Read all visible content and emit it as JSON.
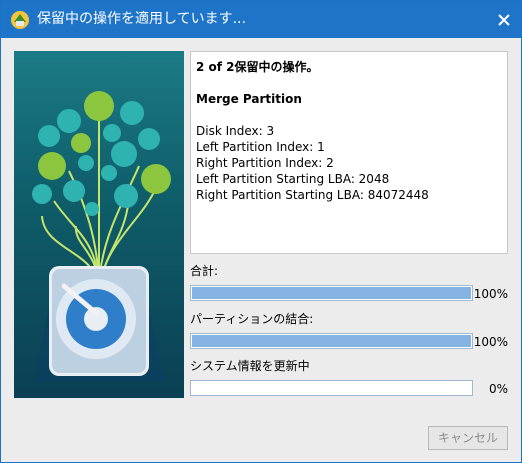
{
  "dialog": {
    "title": "保留中の操作を適用しています...",
    "colors": {
      "titlebar": "#1e74c9",
      "progress_fill": "#86b3e4",
      "illustration_bg": "#0f5f6b"
    }
  },
  "info": {
    "count": "2 of 2保留中の操作。",
    "operation": "Merge Partition",
    "details": [
      "Disk Index: 3",
      "Left Partition Index: 1",
      "Right Partition Index: 2",
      "Left Partition Starting LBA: 2048",
      "Right Partition Starting LBA: 84072448"
    ]
  },
  "progress": [
    {
      "label": "合計:",
      "percent_text": "100%",
      "value": 1.0
    },
    {
      "label": "パーティションの結合:",
      "percent_text": "100%",
      "value": 1.0
    },
    {
      "label": "システム情報を更新中",
      "percent_text": "0%",
      "value": 0.0
    }
  ],
  "buttons": {
    "cancel": "キャンセル"
  },
  "icons": [
    "app-icon",
    "close-icon",
    "hard-drive-icon"
  ]
}
